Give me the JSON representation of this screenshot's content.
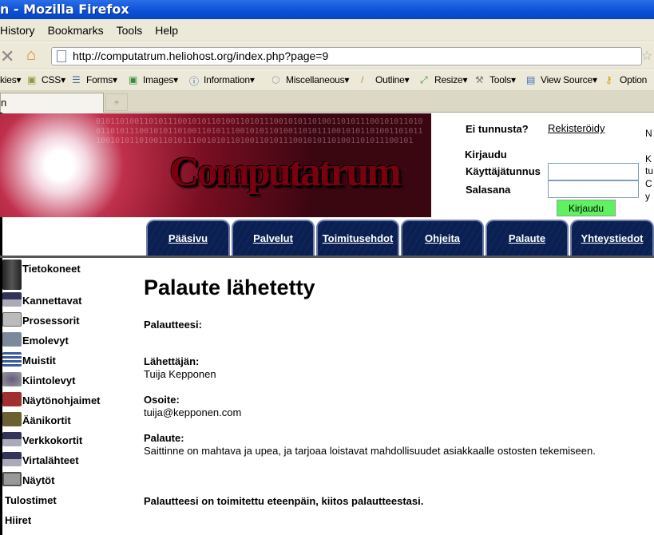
{
  "window": {
    "title": "n - Mozilla Firefox"
  },
  "menu": [
    "History",
    "Bookmarks",
    "Tools",
    "Help"
  ],
  "address": {
    "url": "http://computatrum.heliohost.org/index.php?page=9"
  },
  "devtoolbar": [
    "kies▾",
    "CSS▾",
    "Forms▾",
    "Images▾",
    "Information▾",
    "Miscellaneous▾",
    "Outline▾",
    "Resize▾",
    "Tools▾",
    "View Source▾",
    "Option"
  ],
  "tab": {
    "label": "n",
    "new_tab": "+"
  },
  "site": {
    "logo": "Computatrum"
  },
  "login": {
    "no_account": "Ei tunnusta?",
    "register": "Rekisteröidy",
    "heading": "Kirjaudu",
    "username_label": "Käyttäjätunnus",
    "password_label": "Salasana",
    "username_value": "",
    "password_value": "",
    "button": "Kirjaudu"
  },
  "right_clipped": [
    "N",
    "K",
    "tu",
    "C",
    "y"
  ],
  "nav": [
    "Pääsivu",
    "Palvelut",
    "Toimitusehdot",
    "Ohjeita",
    "Palaute",
    "Yhteystiedot"
  ],
  "sidebar": [
    "Tietokoneet",
    "Kannettavat",
    "Prosessorit",
    "Emolevyt",
    "Muistit",
    "Kiintolevyt",
    "Näytönohjaimet",
    "Äänikortit",
    "Verkkokortit",
    "Virtalähteet",
    "Näytöt",
    "Tulostimet",
    "Hiiret"
  ],
  "main": {
    "title": "Palaute lähetetty",
    "your_feedback": "Palautteesi:",
    "sender_label": "Lähettäjän:",
    "sender": "Tuija Kepponen",
    "address_label": "Osoite:",
    "address": "tuija@kepponen.com",
    "feedback_label": "Palaute:",
    "feedback": "Saittinne on mahtava ja upea, ja tarjoaa loistavat mahdollisuudet asiakkaalle ostosten tekemiseen.",
    "confirmation": "Palautteesi on toimitettu eteenpäin, kiitos palautteestasi."
  }
}
